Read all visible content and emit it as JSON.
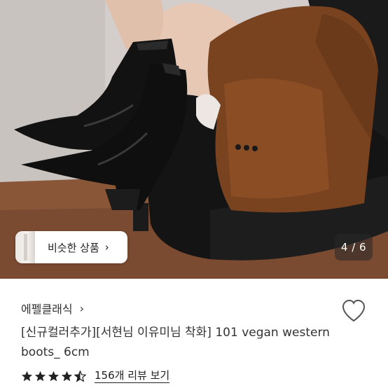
{
  "gallery": {
    "counter": "4 / 6",
    "similar_button": {
      "label": "비슷한 상품",
      "arrow": "›"
    }
  },
  "product": {
    "store_name": "에펠클래식",
    "store_arrow": "›",
    "title": "[신규컬러추가][서현님 이유미님 착화] 101 vegan western boots_ 6cm",
    "rating": 4.5,
    "review_link": "156개 리뷰 보기",
    "icons": {
      "wishlist": "heart-outline-icon",
      "star": "star-icon"
    },
    "colors": {
      "star": "#222222",
      "text": "#333333"
    }
  }
}
